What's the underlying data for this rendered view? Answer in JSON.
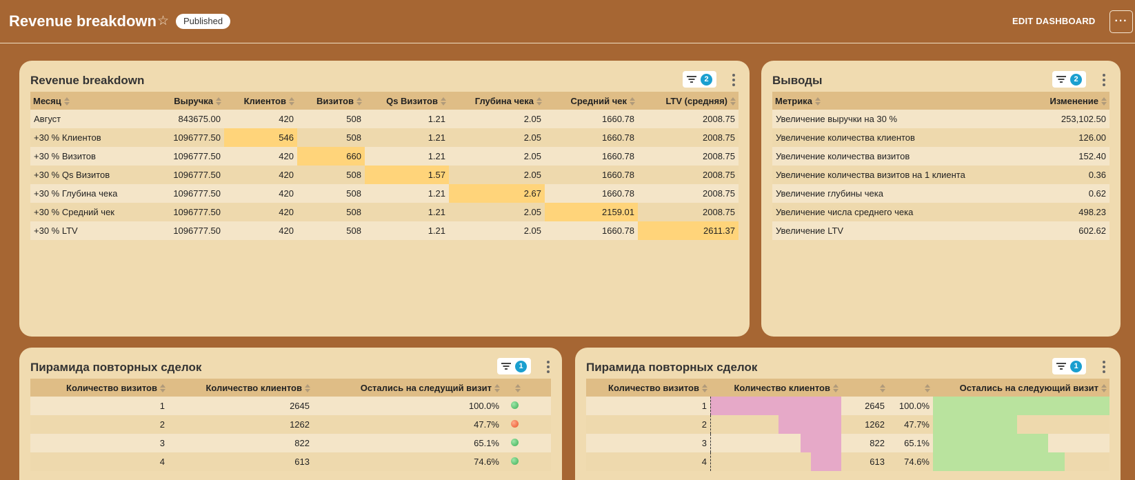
{
  "header": {
    "title": "Revenue breakdown",
    "status": "Published",
    "edit_label": "EDIT DASHBOARD",
    "more_label": "···"
  },
  "panels": {
    "revenue": {
      "title": "Revenue breakdown",
      "filter_count": "2",
      "columns": [
        "Месяц",
        "Выручка",
        "Клиентов",
        "Визитов",
        "Qs Визитов",
        "Глубина чека",
        "Средний чек",
        "LTV (средняя)"
      ],
      "rows": [
        [
          "Август",
          "843675.00",
          "420",
          "508",
          "1.21",
          "2.05",
          "1660.78",
          "2008.75"
        ],
        [
          "+30 % Клиентов",
          "1096777.50",
          "546",
          "508",
          "1.21",
          "2.05",
          "1660.78",
          "2008.75"
        ],
        [
          "+30 % Визитов",
          "1096777.50",
          "420",
          "660",
          "1.21",
          "2.05",
          "1660.78",
          "2008.75"
        ],
        [
          "+30 % Qs Визитов",
          "1096777.50",
          "420",
          "508",
          "1.57",
          "2.05",
          "1660.78",
          "2008.75"
        ],
        [
          "+30 % Глубина чека",
          "1096777.50",
          "420",
          "508",
          "1.21",
          "2.67",
          "1660.78",
          "2008.75"
        ],
        [
          "+30 % Средний чек",
          "1096777.50",
          "420",
          "508",
          "1.21",
          "2.05",
          "2159.01",
          "2008.75"
        ],
        [
          "+30 % LTV",
          "1096777.50",
          "420",
          "508",
          "1.21",
          "2.05",
          "1660.78",
          "2611.37"
        ]
      ],
      "highlights": [
        [
          1,
          2
        ],
        [
          2,
          3
        ],
        [
          3,
          4
        ],
        [
          4,
          5
        ],
        [
          5,
          6
        ],
        [
          6,
          7
        ]
      ],
      "highlight_color": "#ffd47a"
    },
    "conclusions": {
      "title": "Выводы",
      "filter_count": "2",
      "columns": [
        "Метрика",
        "Изменение"
      ],
      "rows": [
        [
          "Увеличение выручки на 30 %",
          "253,102.50"
        ],
        [
          "Увеличение количества клиентов",
          "126.00"
        ],
        [
          "Увеличение количества визитов",
          "152.40"
        ],
        [
          "Увеличение количества визитов на 1 клиента",
          "0.36"
        ],
        [
          "Увеличение глубины чека",
          "0.62"
        ],
        [
          "Увеличение числа среднего чека",
          "498.23"
        ],
        [
          "Увеличение LTV",
          "602.62"
        ]
      ]
    },
    "pyramid_left": {
      "title": "Пирамида повторных сделок",
      "filter_count": "1",
      "columns": [
        "Количество визитов",
        "Количество клиентов",
        "Остались на следущий визит",
        ""
      ],
      "rows": [
        {
          "visits": "1",
          "clients": "2645",
          "retained": "100.0%",
          "dot": "green"
        },
        {
          "visits": "2",
          "clients": "1262",
          "retained": "47.7%",
          "dot": "red"
        },
        {
          "visits": "3",
          "clients": "822",
          "retained": "65.1%",
          "dot": "green"
        },
        {
          "visits": "4",
          "clients": "613",
          "retained": "74.6%",
          "dot": "green"
        }
      ]
    },
    "pyramid_right": {
      "title": "Пирамида повторных сделок",
      "filter_count": "1",
      "columns": [
        "Количество визитов",
        "Количество клиентов",
        "",
        "",
        "Остались на следующий визит"
      ],
      "rows": [
        {
          "visits": "1",
          "clients": "2645",
          "retained": "100.0%",
          "clients_share": 1.0,
          "retained_share": 1.0
        },
        {
          "visits": "2",
          "clients": "1262",
          "retained": "47.7%",
          "clients_share": 0.477,
          "retained_share": 0.477
        },
        {
          "visits": "3",
          "clients": "822",
          "retained": "65.1%",
          "clients_share": 0.311,
          "retained_share": 0.651
        },
        {
          "visits": "4",
          "clients": "613",
          "retained": "74.6%",
          "clients_share": 0.232,
          "retained_share": 0.746
        }
      ],
      "colors": {
        "clients_bar": "#e6a9c8",
        "retained_bar": "#b9e39e"
      }
    }
  }
}
